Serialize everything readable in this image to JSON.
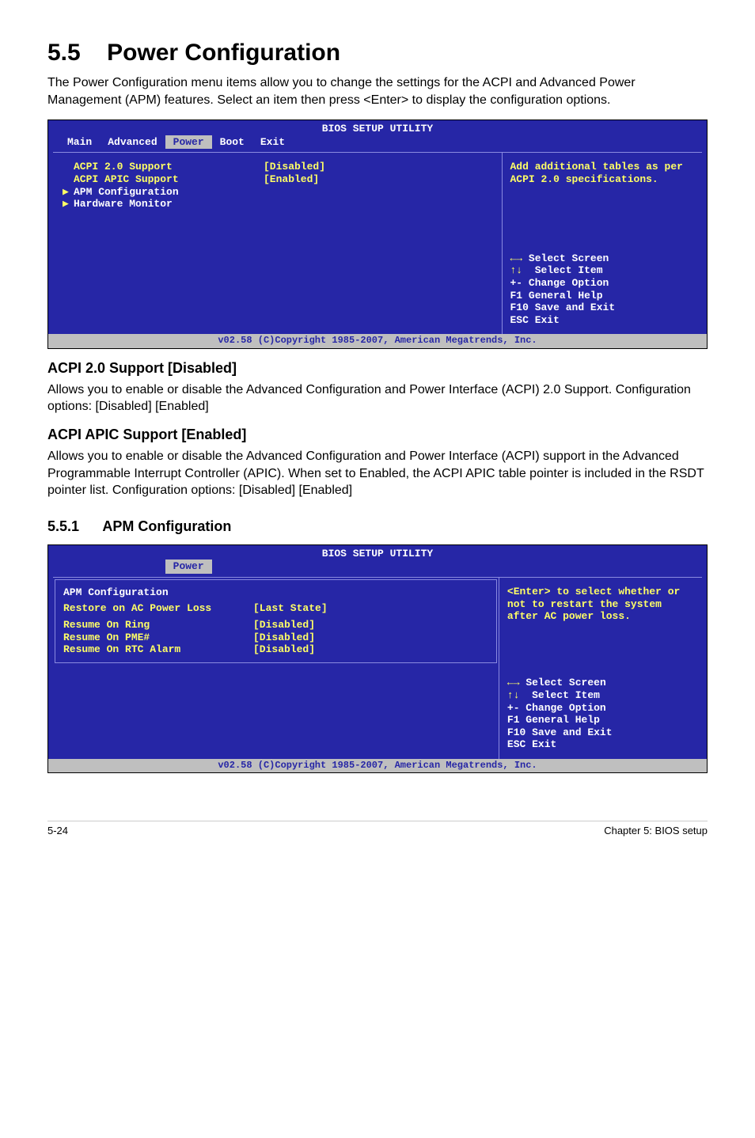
{
  "section": {
    "number": "5.5",
    "title": "Power Configuration",
    "intro": "The Power Configuration menu items allow you to change the settings for the ACPI and Advanced Power Management (APM) features. Select an item then press <Enter> to display the configuration options."
  },
  "bios1": {
    "title": "BIOS SETUP UTILITY",
    "tabs": [
      "Main",
      "Advanced",
      "Power",
      "Boot",
      "Exit"
    ],
    "activeTab": "Power",
    "rows": [
      {
        "label": "ACPI 2.0 Support",
        "value": "[Disabled]",
        "arrow": false,
        "white": false
      },
      {
        "label": "ACPI APIC Support",
        "value": "[Enabled]",
        "arrow": false,
        "white": false
      },
      {
        "label": "APM Configuration",
        "value": "",
        "arrow": true,
        "white": true
      },
      {
        "label": "Hardware Monitor",
        "value": "",
        "arrow": true,
        "white": true
      }
    ],
    "helpTop": "Add additional tables as per ACPI 2.0 specifications.",
    "helpBottom": {
      "l1": "Select Screen",
      "l2": "Select Item",
      "l3": "+- Change Option",
      "l4": "F1 General Help",
      "l5": "F10 Save and Exit",
      "l6": "ESC Exit"
    },
    "footer": "v02.58 (C)Copyright 1985-2007, American Megatrends, Inc."
  },
  "acpi20": {
    "heading": "ACPI 2.0 Support [Disabled]",
    "text": "Allows you to enable or disable the Advanced Configuration and Power Interface (ACPI) 2.0 Support. Configuration options: [Disabled] [Enabled]"
  },
  "acpiApic": {
    "heading": "ACPI APIC Support [Enabled]",
    "text": "Allows you to enable or disable the Advanced Configuration and Power Interface (ACPI) support in the Advanced Programmable Interrupt Controller (APIC). When set to Enabled, the ACPI APIC table pointer is included in the RSDT pointer list. Configuration options: [Disabled] [Enabled]"
  },
  "sub551": {
    "number": "5.5.1",
    "title": "APM Configuration"
  },
  "bios2": {
    "title": "BIOS SETUP UTILITY",
    "activeTab": "Power",
    "subTitle": "APM Configuration",
    "rows": [
      {
        "label": "Restore on AC Power Loss",
        "value": "[Last State]"
      },
      {
        "label": "Resume On Ring",
        "value": "[Disabled]"
      },
      {
        "label": "Resume On PME#",
        "value": "[Disabled]"
      },
      {
        "label": "Resume On RTC Alarm",
        "value": "[Disabled]"
      }
    ],
    "helpTop": "<Enter> to select whether or not to restart the system after AC power loss.",
    "helpBottom": {
      "l1": "Select Screen",
      "l2": "Select Item",
      "l3": "+- Change Option",
      "l4": "F1 General Help",
      "l5": "F10 Save and Exit",
      "l6": "ESC Exit"
    },
    "footer": "v02.58 (C)Copyright 1985-2007, American Megatrends, Inc."
  },
  "footer": {
    "left": "5-24",
    "right": "Chapter 5: BIOS setup"
  }
}
